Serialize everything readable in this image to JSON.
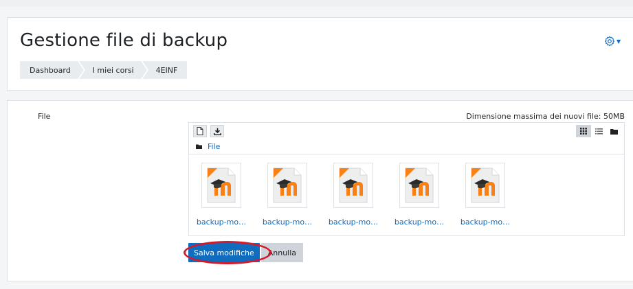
{
  "page": {
    "title": "Gestione file di backup"
  },
  "header": {
    "settings_icon": "gear-icon",
    "dropdown_icon": "caret-down-icon"
  },
  "breadcrumb": [
    {
      "label": "Dashboard"
    },
    {
      "label": "I miei corsi"
    },
    {
      "label": "4EINF"
    }
  ],
  "form": {
    "field_label": "File",
    "max_size_text": "Dimensione massima dei nuovi file: 50MB"
  },
  "filepicker": {
    "toolbar": {
      "add_icon": "file-add-icon",
      "download_icon": "download-icon",
      "views": [
        "grid-view-icon",
        "list-view-icon",
        "folder-view-icon"
      ],
      "active_view": "grid-view-icon"
    },
    "path": {
      "folder_icon": "folder-icon",
      "label": "File"
    },
    "files": [
      {
        "name": "backup-mo…",
        "icon": "moodle-backup-icon"
      },
      {
        "name": "backup-mo…",
        "icon": "moodle-backup-icon"
      },
      {
        "name": "backup-mo…",
        "icon": "moodle-backup-icon"
      },
      {
        "name": "backup-mo…",
        "icon": "moodle-backup-icon"
      },
      {
        "name": "backup-mo…",
        "icon": "moodle-backup-icon"
      }
    ]
  },
  "buttons": {
    "save_label": "Salva modifiche",
    "cancel_label": "Annulla"
  },
  "colors": {
    "primary": "#0f6cbf",
    "highlight": "#d41a2a",
    "moodle_orange": "#f98012"
  }
}
